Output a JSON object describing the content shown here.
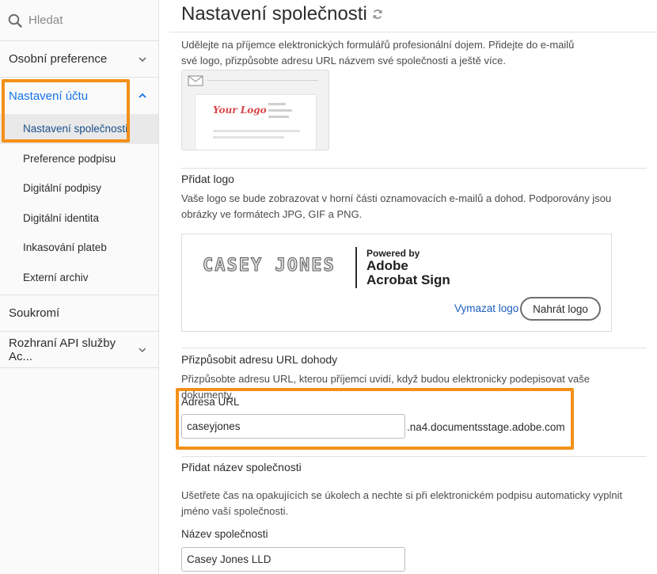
{
  "sidebar": {
    "search_label": "Hledat",
    "items": [
      {
        "label": "Osobní preference"
      },
      {
        "label": "Nastavení účtu"
      },
      {
        "label": "Soukromí"
      },
      {
        "label": "Rozhraní API služby Ac..."
      }
    ],
    "sub_items": [
      {
        "label": "Nastavení společnosti"
      },
      {
        "label": "Preference podpisu"
      },
      {
        "label": "Digitální podpisy"
      },
      {
        "label": "Digitální identita"
      },
      {
        "label": "Inkasování plateb"
      },
      {
        "label": "Externí archiv"
      }
    ]
  },
  "main": {
    "title": "Nastavení společnosti",
    "intro": "Udělejte na příjemce elektronických formulářů profesionální dojem. Přidejte do e-mailů své logo, přizpůsobte adresu URL názvem své společnosti a ještě více.",
    "preview_logo_text": "Your Logo",
    "add_logo": {
      "heading": "Přidat logo",
      "description": "Vaše logo se bude zobrazovat v horní části oznamovacích e-mailů a dohod. Podporovány jsou obrázky ve formátech JPG, GIF a PNG.",
      "logo_image_text": "CASEY JONES",
      "powered_by": "Powered by",
      "adobe": "Adobe",
      "acrobat_sign": "Acrobat Sign",
      "clear_label": "Vymazat logo",
      "upload_label": "Nahrát logo"
    },
    "url": {
      "heading": "Přizpůsobit adresu URL dohody",
      "description": "Přizpůsobte adresu URL, kterou příjemci uvidí, když budou elektronicky podepisovat vaše dokumenty.",
      "field_label": "Adresa URL",
      "value": "caseyjones",
      "suffix": ".na4.documentsstage.adobe.com"
    },
    "company": {
      "heading": "Přidat název společnosti",
      "description": "Ušetřete čas na opakujících se úkolech a nechte si při elektronickém podpisu automaticky vyplnit jméno vaší společnosti.",
      "field_label": "Název společnosti",
      "value": "Casey Jones LLD"
    }
  },
  "colors": {
    "accent": "#1473e6",
    "highlight": "#f39019",
    "link": "#1a5fbd"
  },
  "icons": [
    "search-icon",
    "chevron-down-icon",
    "chevron-up-icon",
    "refresh-icon",
    "envelope-icon"
  ]
}
